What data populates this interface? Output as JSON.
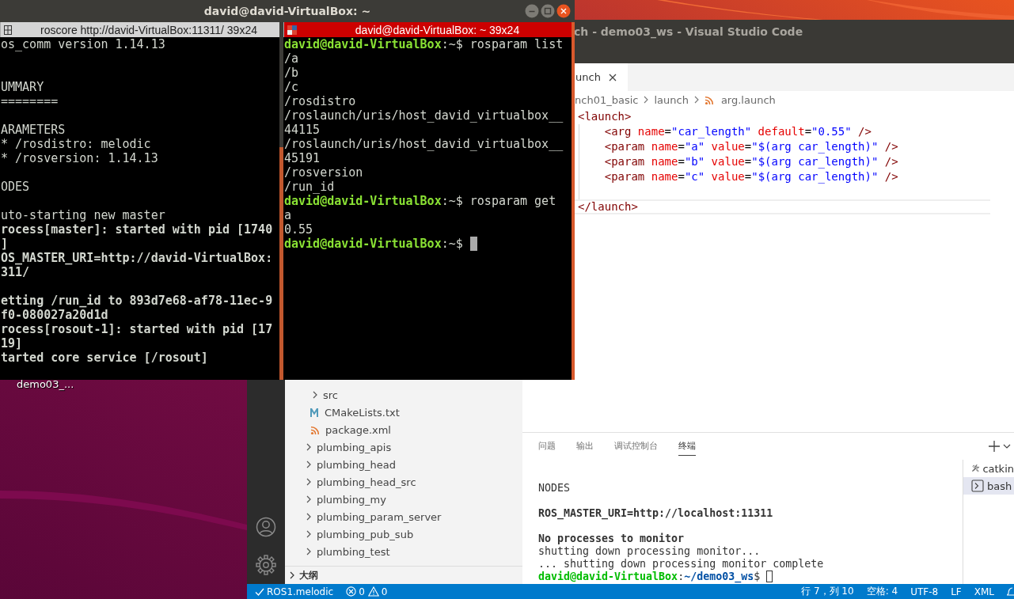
{
  "desktop": {
    "icons": [
      {
        "label": "demo03_..."
      }
    ]
  },
  "vscode": {
    "title": "ch - demo03_ws - Visual Studio Code",
    "explorer": {
      "items": [
        {
          "kind": "group",
          "children": [
            {
              "kind": "folder",
              "label": "src",
              "expanded": false
            },
            {
              "kind": "cmake",
              "label": "CMakeLists.txt"
            },
            {
              "kind": "xml",
              "label": "package.xml"
            }
          ]
        },
        {
          "kind": "folder",
          "label": "plumbing_apis",
          "expanded": false
        },
        {
          "kind": "folder",
          "label": "plumbing_head",
          "expanded": false
        },
        {
          "kind": "folder",
          "label": "plumbing_head_src",
          "expanded": false
        },
        {
          "kind": "folder",
          "label": "plumbing_my",
          "expanded": false
        },
        {
          "kind": "folder",
          "label": "plumbing_param_server",
          "expanded": false
        },
        {
          "kind": "folder",
          "label": "plumbing_pub_sub",
          "expanded": false
        },
        {
          "kind": "folder",
          "label": "plumbing_test",
          "expanded": false
        }
      ],
      "outline": {
        "label": "大纲",
        "expanded": false
      }
    },
    "editor": {
      "tabs": [
        {
          "label": "unch",
          "selected": true
        }
      ],
      "breadcrumb": [
        {
          "label": "nch01_basic",
          "kind": "folder"
        },
        {
          "label": "launch",
          "kind": "folder"
        },
        {
          "label": "arg.launch",
          "kind": "xml"
        }
      ],
      "lines": [
        {
          "segments": [
            {
              "text": "<launch>",
              "kind": "tag"
            }
          ]
        },
        {
          "segments": [
            {
              "text": "    <arg",
              "kind": "tag"
            },
            {
              "text": " name",
              "kind": "attr"
            },
            {
              "text": "=",
              "kind": "plain"
            },
            {
              "text": "\"car_length\"",
              "kind": "string"
            },
            {
              "text": " default",
              "kind": "attr"
            },
            {
              "text": "=",
              "kind": "plain"
            },
            {
              "text": "\"0.55\"",
              "kind": "string"
            },
            {
              "text": " />",
              "kind": "tag"
            }
          ]
        },
        {
          "segments": [
            {
              "text": "    <param",
              "kind": "tag"
            },
            {
              "text": " name",
              "kind": "attr"
            },
            {
              "text": "=",
              "kind": "plain"
            },
            {
              "text": "\"a\"",
              "kind": "string"
            },
            {
              "text": " value",
              "kind": "attr"
            },
            {
              "text": "=",
              "kind": "plain"
            },
            {
              "text": "\"$(arg car_length)\"",
              "kind": "string"
            },
            {
              "text": " />",
              "kind": "tag"
            }
          ]
        },
        {
          "segments": [
            {
              "text": "    <param",
              "kind": "tag"
            },
            {
              "text": " name",
              "kind": "attr"
            },
            {
              "text": "=",
              "kind": "plain"
            },
            {
              "text": "\"b\"",
              "kind": "string"
            },
            {
              "text": " value",
              "kind": "attr"
            },
            {
              "text": "=",
              "kind": "plain"
            },
            {
              "text": "\"$(arg car_length)\"",
              "kind": "string"
            },
            {
              "text": " />",
              "kind": "tag"
            }
          ]
        },
        {
          "segments": [
            {
              "text": "    <param",
              "kind": "tag"
            },
            {
              "text": " name",
              "kind": "attr"
            },
            {
              "text": "=",
              "kind": "plain"
            },
            {
              "text": "\"c\"",
              "kind": "string"
            },
            {
              "text": " value",
              "kind": "attr"
            },
            {
              "text": "=",
              "kind": "plain"
            },
            {
              "text": "\"$(arg car_length)\"",
              "kind": "string"
            },
            {
              "text": " />",
              "kind": "tag"
            }
          ]
        },
        {
          "kind": "blank"
        },
        {
          "current": true,
          "segments": [
            {
              "text": "</launch>",
              "kind": "tag"
            }
          ]
        }
      ]
    },
    "panel": {
      "tabs": [
        {
          "label": "问题",
          "selected": false
        },
        {
          "label": "输出",
          "selected": false
        },
        {
          "label": "调试控制台",
          "selected": false
        },
        {
          "label": "终端",
          "selected": true
        }
      ],
      "terminal_lines": [
        {
          "kind": "blank"
        },
        {
          "text": "NODES"
        },
        {
          "kind": "blank"
        },
        {
          "text": "ROS_MASTER_URI=http://localhost:11311",
          "bold": true
        },
        {
          "kind": "blank"
        },
        {
          "text": "No processes to monitor",
          "bold": true
        },
        {
          "text": "shutting down processing monitor..."
        },
        {
          "text": "... shutting down processing monitor complete"
        },
        {
          "cursor": true,
          "segments": [
            {
              "text": "david@david-VirtualBox",
              "kind": "user"
            },
            {
              "text": ":",
              "kind": "plain"
            },
            {
              "text": "~/demo03_ws",
              "kind": "path"
            },
            {
              "text": "$ ",
              "kind": "plain"
            }
          ]
        }
      ],
      "terminals": [
        {
          "label": "catkin",
          "kind": "task",
          "selected": false
        },
        {
          "label": "bash",
          "kind": "shell",
          "selected": true
        }
      ]
    },
    "status_bar": {
      "left": [
        {
          "kind": "remote",
          "text": "ROS1.melodic"
        },
        {
          "kind": "errors",
          "text": "0"
        },
        {
          "kind": "warnings",
          "text": "0"
        }
      ],
      "right": [
        "行 7，列 10",
        "空格: 4",
        "UTF-8",
        "LF",
        "XML"
      ]
    }
  },
  "terminal_window": {
    "title": "david@david-VirtualBox: ~",
    "panes": [
      {
        "title": "roscore http://david-VirtualBox:11311/ 39x24",
        "focused": false,
        "lines": [
          {
            "text": "os_comm version 1.14.13"
          },
          {
            "kind": "blank"
          },
          {
            "kind": "blank"
          },
          {
            "text": "UMMARY"
          },
          {
            "text": "========"
          },
          {
            "kind": "blank"
          },
          {
            "text": "ARAMETERS"
          },
          {
            "text": "* /rosdistro: melodic"
          },
          {
            "text": "* /rosversion: 1.14.13"
          },
          {
            "kind": "blank"
          },
          {
            "text": "ODES"
          },
          {
            "kind": "blank"
          },
          {
            "text": "uto-starting new master"
          },
          {
            "text": "rocess[master]: started with pid [1740",
            "bold": true
          },
          {
            "text": "]",
            "bold": true
          },
          {
            "text": "OS_MASTER_URI=http://david-VirtualBox:",
            "bold": true
          },
          {
            "text": "311/",
            "bold": true
          },
          {
            "kind": "blank"
          },
          {
            "text": "etting /run_id to 893d7e68-af78-11ec-9",
            "bold": true
          },
          {
            "text": "f0-080027a20d1d",
            "bold": true
          },
          {
            "text": "rocess[rosout-1]: started with pid [17",
            "bold": true
          },
          {
            "text": "19]",
            "bold": true
          },
          {
            "text": "tarted core service [/rosout]",
            "bold": true
          }
        ]
      },
      {
        "title": "david@david-VirtualBox: ~ 39x24",
        "focused": true,
        "lines": [
          {
            "segments": [
              {
                "text": "david@david-VirtualBox",
                "kind": "user"
              },
              {
                "text": ":~$ rosparam list",
                "kind": "plain"
              }
            ]
          },
          {
            "text": "/a"
          },
          {
            "text": "/b"
          },
          {
            "text": "/c"
          },
          {
            "text": "/rosdistro"
          },
          {
            "text": "/roslaunch/uris/host_david_virtualbox__"
          },
          {
            "text": "44115"
          },
          {
            "text": "/roslaunch/uris/host_david_virtualbox__"
          },
          {
            "text": "45191"
          },
          {
            "text": "/rosversion"
          },
          {
            "text": "/run_id"
          },
          {
            "segments": [
              {
                "text": "david@david-VirtualBox",
                "kind": "user"
              },
              {
                "text": ":~$ rosparam get",
                "kind": "plain"
              }
            ]
          },
          {
            "text": "a"
          },
          {
            "text": "0.55"
          },
          {
            "cursor": true,
            "segments": [
              {
                "text": "david@david-VirtualBox",
                "kind": "user"
              },
              {
                "text": ":~$ ",
                "kind": "plain"
              }
            ]
          }
        ]
      }
    ]
  }
}
